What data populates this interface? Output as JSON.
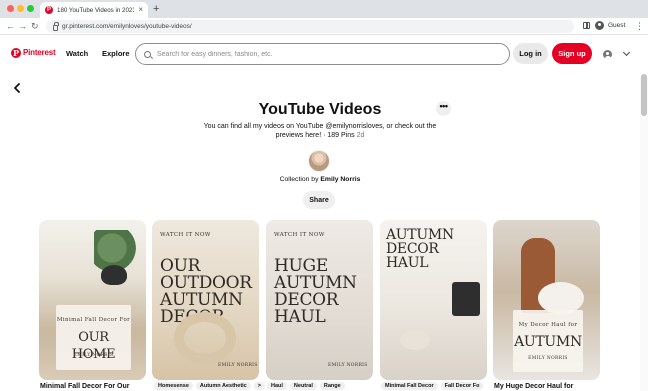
{
  "browser": {
    "tab_title": "180 YouTube Videos in 2023 |",
    "tab_close": "×",
    "new_tab": "+",
    "url": "gr.pinterest.com/emilynloves/youtube-videos/",
    "profile_label": "Guest",
    "nav": {
      "back": "←",
      "forward": "→",
      "reload": "↻",
      "menu": "⋮"
    }
  },
  "header": {
    "logo_mark": "P",
    "logo_text": "Pinterest",
    "nav_watch": "Watch",
    "nav_explore": "Explore",
    "search_placeholder": "Search for easy dinners, fashion, etc.",
    "login_label": "Log in",
    "signup_label": "Sign up"
  },
  "board": {
    "title": "YouTube Videos",
    "more_label": "•••",
    "description": "You can find all my videos on YouTube @emilynorrisloves, or check out the previews here! · 189 Pins",
    "age": "2d",
    "collection_prefix": "Collection by",
    "curator_name": "Emily Norris",
    "share_label": "Share"
  },
  "pins": [
    {
      "overlay_kicker": "Minimal Fall Decor For",
      "overlay_big": "OUR HOME",
      "overlay_small": "EMILY NORRIS",
      "caption": "Minimal Fall Decor For Our"
    },
    {
      "overlay_kicker": "WATCH IT NOW",
      "overlay_big": "OUR OUTDOOR AUTUMN DECOR",
      "overlay_small": "EMILY NORRIS",
      "tags": [
        "Homesense",
        "Autumn Aesthetic",
        ">"
      ]
    },
    {
      "overlay_kicker": "WATCH IT NOW",
      "overlay_big": "HUGE AUTUMN DECOR HAUL",
      "overlay_small": "EMILY NORRIS",
      "tags": [
        "Haul",
        "Neutral",
        "Range"
      ]
    },
    {
      "overlay_big": "AUTUMN DECOR HAUL",
      "tags": [
        "Minimal Fall Decor",
        "Fall Decor Fo"
      ]
    },
    {
      "overlay_kicker": "My Decor Haul for",
      "overlay_big": "AUTUMN",
      "overlay_small": "EMILY NORRIS",
      "caption": "My Huge Decor Haul for"
    }
  ]
}
